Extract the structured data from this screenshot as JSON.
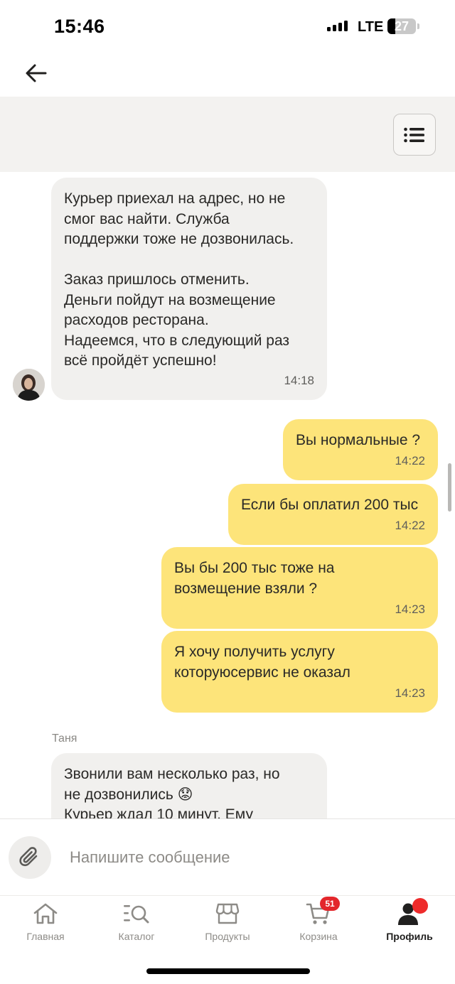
{
  "status_bar": {
    "time": "15:46",
    "network": "LTE",
    "battery": "27",
    "battery_level": 0.27
  },
  "chat": {
    "messages": [
      {
        "direction": "incoming",
        "text": "Курьер приехал на адрес, но не\nсмог вас найти. Служба\nподдержки тоже не дозвонилась.\n\nЗаказ пришлось отменить.\nДеньги пойдут на возмещение\nрасходов ресторана.\nНадеемся, что в следующий раз\nвсё пройдёт успешно!",
        "time": "14:18"
      },
      {
        "direction": "outgoing",
        "text": "Вы нормальные ?",
        "time": "14:22"
      },
      {
        "direction": "outgoing",
        "text": "Если бы оплатил 200 тыс",
        "time": "14:22"
      },
      {
        "direction": "outgoing",
        "text": "Вы бы 200 тыс тоже на\nвозмещение взяли ?",
        "time": "14:23"
      },
      {
        "direction": "outgoing",
        "text": "Я хочу получить услугу\nкоторуюсервис не оказал",
        "time": "14:23"
      },
      {
        "direction": "incoming",
        "text": "Звонили вам несколько раз, но\nне дозвонились 😟\nКурьер ждал 10 минут. Ему",
        "time": ""
      }
    ],
    "sender_name": "Таня"
  },
  "input": {
    "placeholder": "Напишите сообщение"
  },
  "bottom_nav": {
    "items": [
      {
        "label": "Главная",
        "icon": "home-icon"
      },
      {
        "label": "Каталог",
        "icon": "catalog-search-icon"
      },
      {
        "label": "Продукты",
        "icon": "store-icon"
      },
      {
        "label": "Корзина",
        "icon": "cart-icon",
        "badge": "51"
      },
      {
        "label": "Профиль",
        "icon": "profile-icon",
        "active": true
      }
    ]
  },
  "colors": {
    "outgoing_bubble": "#fde47a",
    "incoming_bubble": "#f1f0ee",
    "badge": "#e3262b"
  }
}
